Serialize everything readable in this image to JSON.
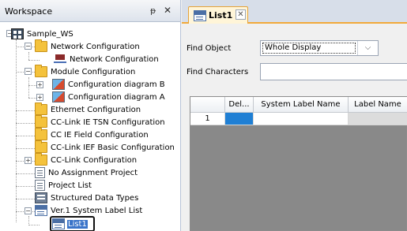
{
  "workspace": {
    "title": "Workspace",
    "pin_glyph": "ᵽ",
    "close_glyph": "✕",
    "tree": {
      "root": "Sample_WS",
      "items": [
        "Network Configuration",
        "Network Configuration",
        "Module Configuration",
        "Configuration diagram B",
        "Configuration diagram A",
        "Ethernet Configuration",
        "CC-Link IE TSN Configuration",
        "CC IE Field Configuration",
        "CC-Link IEF Basic Configuration",
        "CC-Link Configuration",
        "No Assignment Project",
        "Project List",
        "Structured Data Types",
        "Ver.1 System Label List",
        "List1"
      ]
    }
  },
  "tab": {
    "label": "List1",
    "close_glyph": "✕"
  },
  "search": {
    "find_object_label": "Find Object",
    "find_object_value": "Whole Display",
    "dropdown_arrow": "⌵",
    "find_characters_label": "Find Characters",
    "find_characters_value": ""
  },
  "grid": {
    "columns": [
      "",
      "Del...",
      "System Label Name",
      "Label Name"
    ],
    "rows": [
      {
        "num": "1"
      }
    ]
  },
  "colors": {
    "accent_tab": "#f2a93a",
    "selection": "#3a74c9",
    "grid_background": "#898989"
  }
}
